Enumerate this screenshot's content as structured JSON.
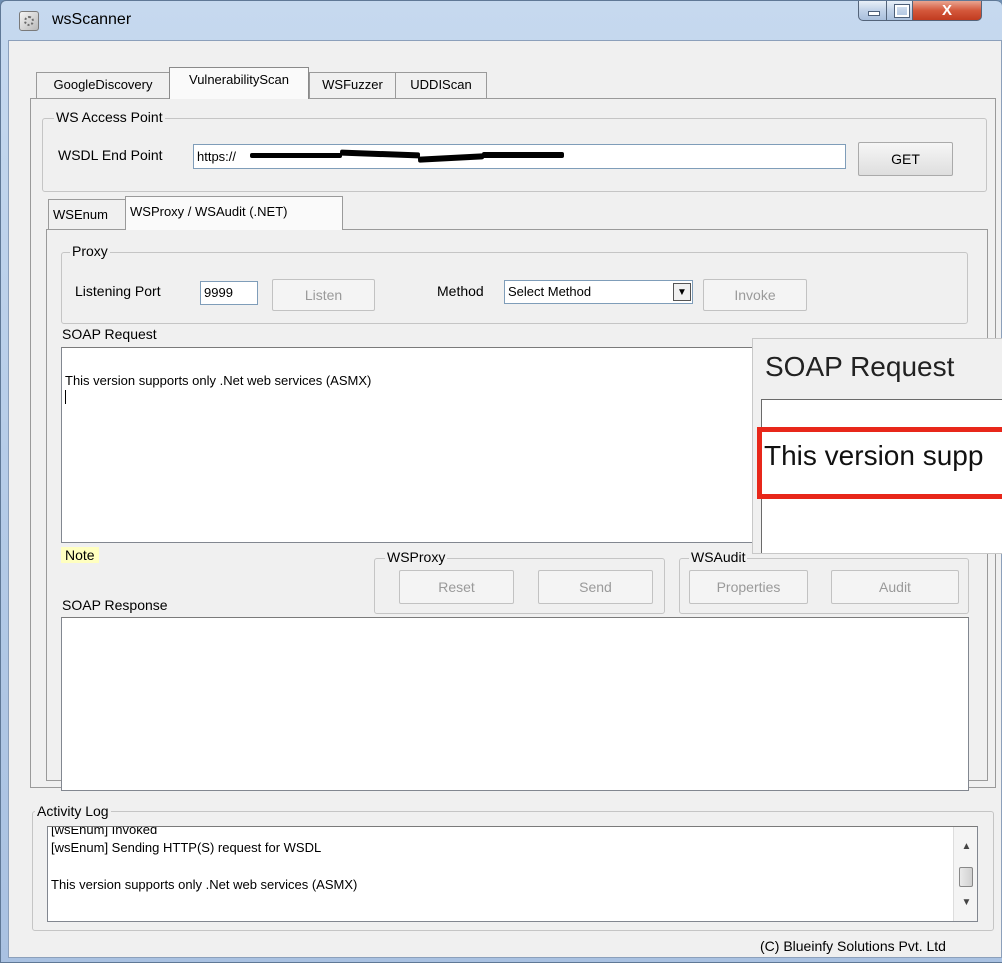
{
  "window": {
    "title": "wsScanner",
    "close_glyph": "X"
  },
  "main_tabs": [
    {
      "label": "GoogleDiscovery"
    },
    {
      "label": "VulnerabilityScan"
    },
    {
      "label": "WSFuzzer"
    },
    {
      "label": "UDDIScan"
    }
  ],
  "access_point": {
    "group_label": "WS Access Point",
    "wsdl_label": "WSDL End Point",
    "wsdl_value": "https://",
    "get_button": "GET"
  },
  "sub_tabs": [
    {
      "label": "WSEnum"
    },
    {
      "label": "WSProxy / WSAudit (.NET)"
    }
  ],
  "proxy": {
    "group_label": "Proxy",
    "port_label": "Listening Port",
    "port_value": "9999",
    "listen_button": "Listen",
    "method_label": "Method",
    "method_selected": "Select Method",
    "invoke_button": "Invoke"
  },
  "soap_request": {
    "label": "SOAP Request",
    "text": "This version supports only .Net web services (ASMX)"
  },
  "zoom_callout": {
    "title": "SOAP Request",
    "text": "This version supp"
  },
  "note": "Note",
  "wsproxy": {
    "group_label": "WSProxy",
    "reset_button": "Reset",
    "send_button": "Send"
  },
  "wsaudit": {
    "group_label": "WSAudit",
    "properties_button": "Properties",
    "audit_button": "Audit"
  },
  "soap_response": {
    "label": "SOAP Response",
    "text": ""
  },
  "activity_log": {
    "label": "Activity Log",
    "lines": [
      "[wsEnum] Invoked",
      "[wsEnum] Sending HTTP(S) request for WSDL",
      "",
      "This version supports only .Net web services (ASMX)"
    ]
  },
  "footer": {
    "copyright": "(C) Blueinfy Solutions Pvt. Ltd"
  },
  "colors": {
    "highlight": "#e8271a",
    "note_bg": "#ffffc0"
  }
}
